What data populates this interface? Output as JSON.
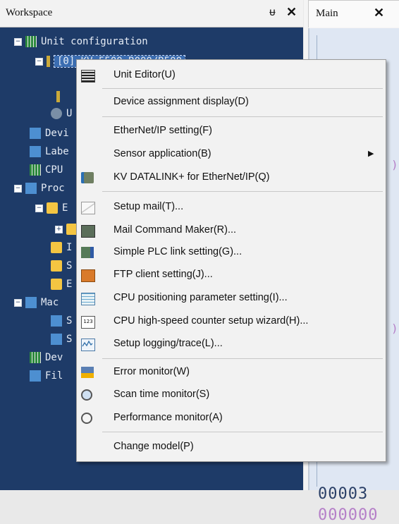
{
  "workspace": {
    "title": "Workspace",
    "pin_glyph": "ᵾ",
    "close_glyph": "✕",
    "tree": [
      {
        "label": "Unit configuration",
        "indent": 0,
        "icon": "grid-icon"
      },
      {
        "label": "[0] KV-5500     R000/R500",
        "indent": 1,
        "icon": "unit-icon"
      },
      {
        "label": "",
        "indent": 2,
        "icon": "unit-icon"
      },
      {
        "label": "U",
        "indent": 2,
        "icon": "gear-icon"
      },
      {
        "label": "Devi",
        "indent": 1,
        "icon": "device-icon"
      },
      {
        "label": "Labe",
        "indent": 1,
        "icon": "label-icon"
      },
      {
        "label": "CPU",
        "indent": 1,
        "icon": "cpu-icon"
      },
      {
        "label": "Proc",
        "indent": 0,
        "icon": "program-icon"
      },
      {
        "label": "E",
        "indent": 1,
        "icon": "folder-icon"
      },
      {
        "label": "",
        "indent": 2,
        "icon": "folder-icon"
      },
      {
        "label": "I",
        "indent": 2,
        "icon": "folder-icon"
      },
      {
        "label": "S",
        "indent": 2,
        "icon": "folder-icon"
      },
      {
        "label": "E",
        "indent": 2,
        "icon": "folder-icon"
      },
      {
        "label": "Mac",
        "indent": 0,
        "icon": "macro-icon"
      },
      {
        "label": "S",
        "indent": 1,
        "icon": "macro-icon"
      },
      {
        "label": "S",
        "indent": 1,
        "icon": "macro-icon"
      },
      {
        "label": "Dev",
        "indent": 1,
        "icon": "device-icon"
      },
      {
        "label": "Fil",
        "indent": 1,
        "icon": "file-icon"
      }
    ]
  },
  "main_tab": {
    "label": "Main",
    "close_glyph": "✕",
    "value_1": "00003",
    "value_2": "000000"
  },
  "context_menu": {
    "items": [
      {
        "label": "Unit Editor(U)",
        "icon": "unit-editor-icon"
      },
      {
        "label": "Device assignment display(D)",
        "icon": ""
      },
      {
        "label": "EtherNet/IP setting(F)",
        "icon": ""
      },
      {
        "label": "Sensor application(B)",
        "icon": "",
        "submenu": true
      },
      {
        "label": "KV DATALINK+ for EtherNet/IP(Q)",
        "icon": "datalink-icon"
      },
      {
        "label": "Setup mail(T)...",
        "icon": "mail-icon"
      },
      {
        "label": "Mail Command Maker(R)...",
        "icon": "mail-command-icon"
      },
      {
        "label": "Simple PLC link setting(G)...",
        "icon": "plc-link-icon"
      },
      {
        "label": "FTP client setting(J)...",
        "icon": "ftp-icon"
      },
      {
        "label": "CPU positioning parameter setting(I)...",
        "icon": "positioning-icon"
      },
      {
        "label": "CPU high-speed counter setup wizard(H)...",
        "icon": "counter-123-icon"
      },
      {
        "label": "Setup logging/trace(L)...",
        "icon": "logging-icon"
      },
      {
        "label": "Error monitor(W)",
        "icon": "error-monitor-icon"
      },
      {
        "label": "Scan time monitor(S)",
        "icon": "scan-time-icon"
      },
      {
        "label": "Performance monitor(A)",
        "icon": "performance-icon"
      },
      {
        "label": "Change model(P)",
        "icon": ""
      }
    ],
    "submenu_arrow": "▶"
  }
}
